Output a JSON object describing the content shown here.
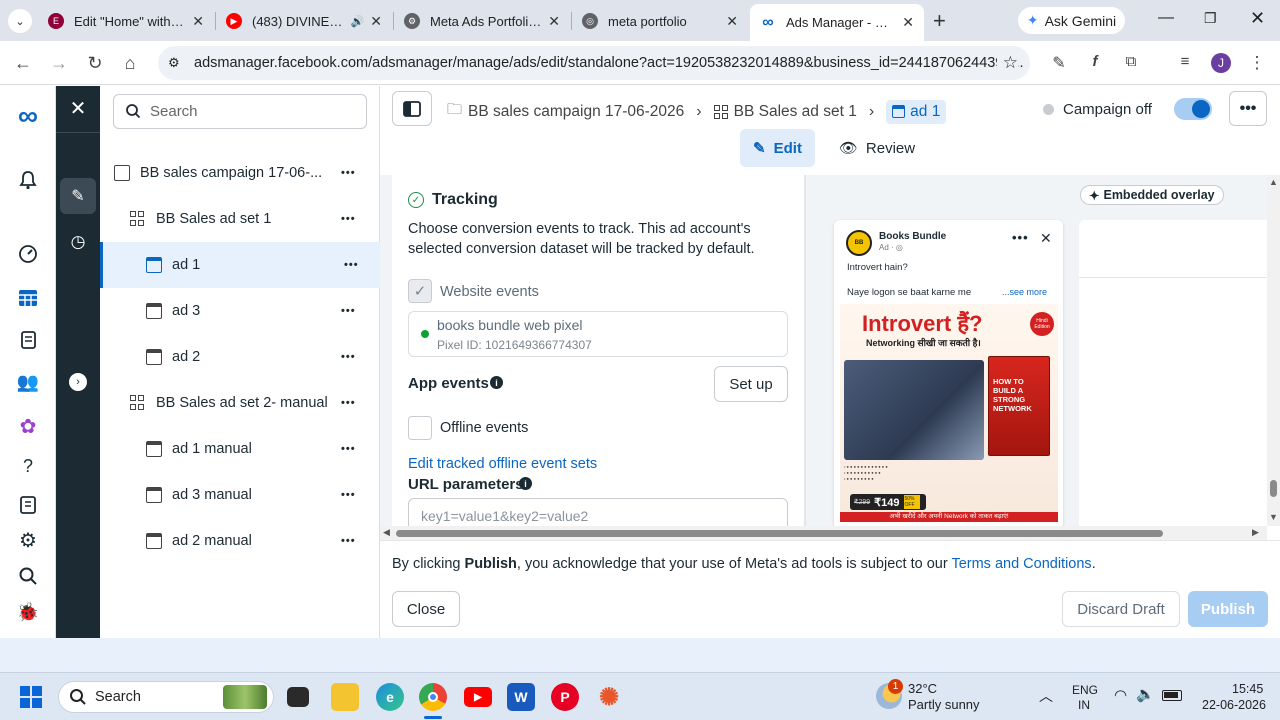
{
  "browser": {
    "tabs": [
      {
        "title": "Edit \"Home\" with Ele",
        "fav_color": "#92003b",
        "fav_text": "E",
        "audio": false
      },
      {
        "title": "(483) DIVINE - M",
        "fav_color": "#ff0000",
        "fav_text": "▶",
        "audio": true
      },
      {
        "title": "Meta Ads Portfolio C",
        "fav_color": "#5f6368",
        "fav_text": "⚙",
        "audio": false
      },
      {
        "title": "meta portfolio",
        "fav_color": "#5f6368",
        "fav_text": "◎",
        "audio": false
      },
      {
        "title": "Ads Manager - Man",
        "fav_color": "#0a66c2",
        "fav_text": "∞",
        "audio": false
      }
    ],
    "new_tab": "+",
    "gemini_label": "Ask Gemini",
    "url": "adsmanager.facebook.com/adsmanager/manage/ads/edit/standalone?act=1920538232014889&business_id=24418706244398...",
    "profile_initial": "J"
  },
  "sidebar": {
    "search_placeholder": "Search",
    "items": [
      {
        "label": "BB sales campaign 17-06-...",
        "type": "campaign"
      },
      {
        "label": "BB Sales ad set 1",
        "type": "adset"
      },
      {
        "label": "ad 1",
        "type": "ad",
        "selected": true
      },
      {
        "label": "ad 3",
        "type": "ad"
      },
      {
        "label": "ad 2",
        "type": "ad"
      },
      {
        "label": "BB Sales ad set 2- manual",
        "type": "adset"
      },
      {
        "label": "ad 1 manual",
        "type": "ad"
      },
      {
        "label": "ad 3 manual",
        "type": "ad"
      },
      {
        "label": "ad 2 manual",
        "type": "ad"
      }
    ]
  },
  "breadcrumbs": {
    "campaign": "BB sales campaign 17-06-2026",
    "adset": "BB Sales ad set 1",
    "ad": "ad 1"
  },
  "campaign_status": "Campaign off",
  "modes": {
    "edit": "Edit",
    "review": "Review"
  },
  "tracking": {
    "title": "Tracking",
    "description": "Choose conversion events to track. This ad account's selected conversion dataset will be tracked by default.",
    "website_events": "Website events",
    "pixel_name": "books bundle web pixel",
    "pixel_id": "Pixel ID: 1021649366774307",
    "app_events": "App events",
    "setup_label": "Set up",
    "offline_events": "Offline events",
    "edit_offline_link": "Edit tracked offline event sets",
    "url_params_label": "URL parameters",
    "url_params_placeholder": "key1=value1&key2=value2"
  },
  "preview": {
    "overlay_label": "Embedded overlay",
    "page_name": "Books Bundle",
    "ad_tag": "Ad · ",
    "primary_text": "Introvert hain?",
    "secondary_text": "Naye logon se baat karne me",
    "see_more": "...see more",
    "creative_title": "Introvert हैं?",
    "creative_subtitle": "Networking सीखी जा सकती है।",
    "creative_book_title": "HOW TO BUILD A STRONG NETWORK",
    "creative_badge": "Hindi Edition",
    "price_old": "₹299",
    "price_new": "₹149",
    "discount": "50% OFF",
    "cta_strip": "अभी खरीदें और अपनी Network को ताकत बढ़ाएं!"
  },
  "footer": {
    "terms_prefix": "By clicking ",
    "terms_bold": "Publish",
    "terms_middle": ", you acknowledge that your use of Meta's ad tools is subject to our ",
    "terms_link": "Terms and Conditions",
    "terms_suffix": ".",
    "close": "Close",
    "discard": "Discard Draft",
    "publish": "Publish"
  },
  "taskbar": {
    "search": "Search",
    "weather_temp": "32°C",
    "weather_desc": "Partly sunny",
    "weather_badge": "1",
    "lang_top": "ENG",
    "lang_bottom": "IN",
    "time": "15:45",
    "date": "22-06-2026"
  },
  "colors": {
    "meta_blue": "#0a66c2",
    "dark_rail": "#1c2b33",
    "toggle_blue": "#0a66c2"
  }
}
